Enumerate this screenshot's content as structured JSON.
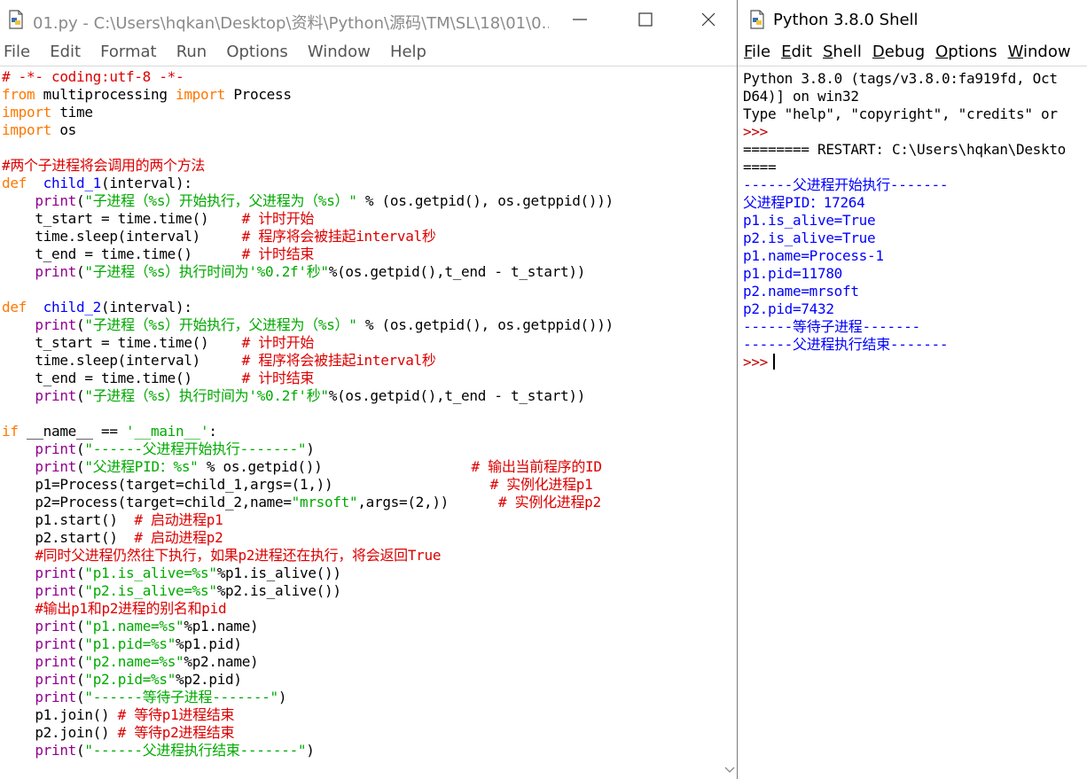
{
  "editor": {
    "title": "01.py - C:\\Users\\hqkan\\Desktop\\资料\\Python\\源码\\TM\\SL\\18\\01\\0...",
    "menu": [
      "File",
      "Edit",
      "Format",
      "Run",
      "Options",
      "Window",
      "Help"
    ],
    "code": [
      [
        [
          "cm",
          "# -*- coding:utf-8 -*-"
        ]
      ],
      [
        [
          "kw",
          "from"
        ],
        [
          "",
          " multiprocessing "
        ],
        [
          "kw",
          "import"
        ],
        [
          "",
          " Process"
        ]
      ],
      [
        [
          "kw",
          "import"
        ],
        [
          "",
          " time"
        ]
      ],
      [
        [
          "kw",
          "import"
        ],
        [
          "",
          " os"
        ]
      ],
      [],
      [
        [
          "cm",
          "#两个子进程将会调用的两个方法"
        ]
      ],
      [
        [
          "kw",
          "def"
        ],
        [
          "",
          "  "
        ],
        [
          "fn",
          "child_1"
        ],
        [
          "",
          "(interval):"
        ]
      ],
      [
        [
          "",
          "    "
        ],
        [
          "bi",
          "print"
        ],
        [
          "",
          "("
        ],
        [
          "str",
          "\"子进程（%s）开始执行，父进程为（%s）\""
        ],
        [
          "",
          " % (os.getpid(), os.getppid()))"
        ]
      ],
      [
        [
          "",
          "    t_start = time.time()    "
        ],
        [
          "cm",
          "# 计时开始"
        ]
      ],
      [
        [
          "",
          "    time.sleep(interval)     "
        ],
        [
          "cm",
          "# 程序将会被挂起interval秒"
        ]
      ],
      [
        [
          "",
          "    t_end = time.time()      "
        ],
        [
          "cm",
          "# 计时结束"
        ]
      ],
      [
        [
          "",
          "    "
        ],
        [
          "bi",
          "print"
        ],
        [
          "",
          "("
        ],
        [
          "str",
          "\"子进程（%s）执行时间为'%0.2f'秒\""
        ],
        [
          "",
          "%(os.getpid(),t_end - t_start))"
        ]
      ],
      [],
      [
        [
          "kw",
          "def"
        ],
        [
          "",
          "  "
        ],
        [
          "fn",
          "child_2"
        ],
        [
          "",
          "(interval):"
        ]
      ],
      [
        [
          "",
          "    "
        ],
        [
          "bi",
          "print"
        ],
        [
          "",
          "("
        ],
        [
          "str",
          "\"子进程（%s）开始执行，父进程为（%s）\""
        ],
        [
          "",
          " % (os.getpid(), os.getppid()))"
        ]
      ],
      [
        [
          "",
          "    t_start = time.time()    "
        ],
        [
          "cm",
          "# 计时开始"
        ]
      ],
      [
        [
          "",
          "    time.sleep(interval)     "
        ],
        [
          "cm",
          "# 程序将会被挂起interval秒"
        ]
      ],
      [
        [
          "",
          "    t_end = time.time()      "
        ],
        [
          "cm",
          "# 计时结束"
        ]
      ],
      [
        [
          "",
          "    "
        ],
        [
          "bi",
          "print"
        ],
        [
          "",
          "("
        ],
        [
          "str",
          "\"子进程（%s）执行时间为'%0.2f'秒\""
        ],
        [
          "",
          "%(os.getpid(),t_end - t_start))"
        ]
      ],
      [],
      [
        [
          "kw",
          "if"
        ],
        [
          "",
          " __name__ == "
        ],
        [
          "str",
          "'__main__'"
        ],
        [
          "",
          ":"
        ]
      ],
      [
        [
          "",
          "    "
        ],
        [
          "bi",
          "print"
        ],
        [
          "",
          "("
        ],
        [
          "str",
          "\"------父进程开始执行-------\""
        ],
        [
          "",
          ")"
        ]
      ],
      [
        [
          "",
          "    "
        ],
        [
          "bi",
          "print"
        ],
        [
          "",
          "("
        ],
        [
          "str",
          "\"父进程PID：%s\""
        ],
        [
          "",
          " % os.getpid())                  "
        ],
        [
          "cm",
          "# 输出当前程序的ID"
        ]
      ],
      [
        [
          "",
          "    p1=Process(target=child_1,args=(1,))                   "
        ],
        [
          "cm",
          "# 实例化进程p1"
        ]
      ],
      [
        [
          "",
          "    p2=Process(target=child_2,name="
        ],
        [
          "str",
          "\"mrsoft\""
        ],
        [
          "",
          ",args=(2,))      "
        ],
        [
          "cm",
          "# 实例化进程p2"
        ]
      ],
      [
        [
          "",
          "    p1.start()  "
        ],
        [
          "cm",
          "# 启动进程p1"
        ]
      ],
      [
        [
          "",
          "    p2.start()  "
        ],
        [
          "cm",
          "# 启动进程p2"
        ]
      ],
      [
        [
          "",
          "    "
        ],
        [
          "cm",
          "#同时父进程仍然往下执行，如果p2进程还在执行，将会返回True"
        ]
      ],
      [
        [
          "",
          "    "
        ],
        [
          "bi",
          "print"
        ],
        [
          "",
          "("
        ],
        [
          "str",
          "\"p1.is_alive=%s\""
        ],
        [
          "",
          "%p1.is_alive())"
        ]
      ],
      [
        [
          "",
          "    "
        ],
        [
          "bi",
          "print"
        ],
        [
          "",
          "("
        ],
        [
          "str",
          "\"p2.is_alive=%s\""
        ],
        [
          "",
          "%p2.is_alive())"
        ]
      ],
      [
        [
          "",
          "    "
        ],
        [
          "cm",
          "#输出p1和p2进程的别名和pid"
        ]
      ],
      [
        [
          "",
          "    "
        ],
        [
          "bi",
          "print"
        ],
        [
          "",
          "("
        ],
        [
          "str",
          "\"p1.name=%s\""
        ],
        [
          "",
          "%p1.name)"
        ]
      ],
      [
        [
          "",
          "    "
        ],
        [
          "bi",
          "print"
        ],
        [
          "",
          "("
        ],
        [
          "str",
          "\"p1.pid=%s\""
        ],
        [
          "",
          "%p1.pid)"
        ]
      ],
      [
        [
          "",
          "    "
        ],
        [
          "bi",
          "print"
        ],
        [
          "",
          "("
        ],
        [
          "str",
          "\"p2.name=%s\""
        ],
        [
          "",
          "%p2.name)"
        ]
      ],
      [
        [
          "",
          "    "
        ],
        [
          "bi",
          "print"
        ],
        [
          "",
          "("
        ],
        [
          "str",
          "\"p2.pid=%s\""
        ],
        [
          "",
          "%p2.pid)"
        ]
      ],
      [
        [
          "",
          "    "
        ],
        [
          "bi",
          "print"
        ],
        [
          "",
          "("
        ],
        [
          "str",
          "\"------等待子进程-------\""
        ],
        [
          "",
          ")"
        ]
      ],
      [
        [
          "",
          "    p1.join() "
        ],
        [
          "cm",
          "# 等待p1进程结束"
        ]
      ],
      [
        [
          "",
          "    p2.join() "
        ],
        [
          "cm",
          "# 等待p2进程结束"
        ]
      ],
      [
        [
          "",
          "    "
        ],
        [
          "bi",
          "print"
        ],
        [
          "",
          "("
        ],
        [
          "str",
          "\"------父进程执行结束-------\""
        ],
        [
          "",
          ")"
        ]
      ]
    ]
  },
  "shell": {
    "title": "Python 3.8.0 Shell",
    "menu": [
      "File",
      "Edit",
      "Shell",
      "Debug",
      "Options",
      "Window"
    ],
    "menu_underline": [
      "F",
      "E",
      "S",
      "D",
      "O",
      "W"
    ],
    "output": [
      [
        [
          "",
          "Python 3.8.0 (tags/v3.8.0:fa919fd, Oct"
        ]
      ],
      [
        [
          "",
          "D64)] on win32"
        ]
      ],
      [
        [
          "",
          "Type \"help\", \"copyright\", \"credits\" or"
        ]
      ],
      [
        [
          "prompt",
          ">>>"
        ]
      ],
      [
        [
          "",
          "======== RESTART: C:\\Users\\hqkan\\Deskto"
        ]
      ],
      [
        [
          "",
          "===="
        ]
      ],
      [
        [
          "out",
          "------父进程开始执行-------"
        ]
      ],
      [
        [
          "out",
          "父进程PID：17264"
        ]
      ],
      [
        [
          "out",
          "p1.is_alive=True"
        ]
      ],
      [
        [
          "out",
          "p2.is_alive=True"
        ]
      ],
      [
        [
          "out",
          "p1.name=Process-1"
        ]
      ],
      [
        [
          "out",
          "p1.pid=11780"
        ]
      ],
      [
        [
          "out",
          "p2.name=mrsoft"
        ]
      ],
      [
        [
          "out",
          "p2.pid=7432"
        ]
      ],
      [
        [
          "out",
          "------等待子进程-------"
        ]
      ],
      [
        [
          "out",
          "------父进程执行结束-------"
        ]
      ],
      [
        [
          "prompt",
          ">>>"
        ]
      ]
    ]
  },
  "colors": {
    "keyword": "#ff7700",
    "string": "#00aa00",
    "comment": "#dd0000",
    "definition": "#0000ff",
    "builtin": "#900090",
    "output": "#0000ff",
    "prompt": "#c00000"
  },
  "icons": [
    "python-file-icon",
    "minimize-icon",
    "maximize-icon",
    "close-icon",
    "python-shell-icon"
  ]
}
